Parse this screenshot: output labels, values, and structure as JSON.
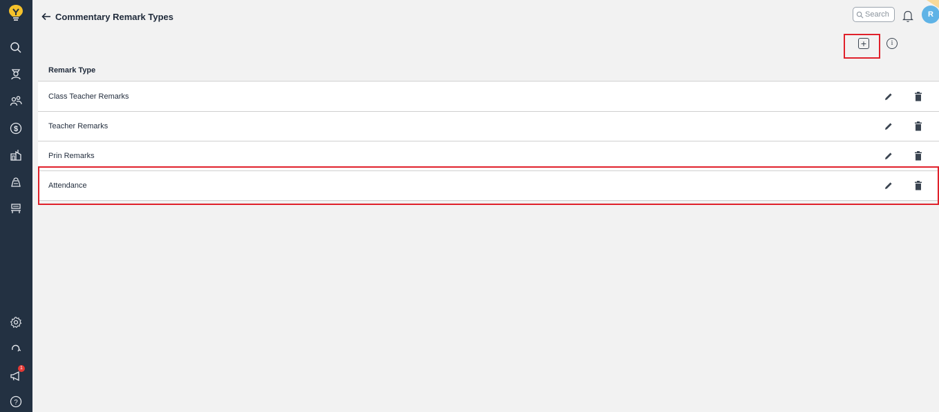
{
  "app": {
    "title": "Commentary Remark Types",
    "search_placeholder": "Search",
    "avatar_initial": "R",
    "notification_count": "1"
  },
  "sidebar": {
    "items": [
      {
        "icon": "search-icon"
      },
      {
        "icon": "student-icon"
      },
      {
        "icon": "users-icon"
      },
      {
        "icon": "dollar-icon"
      },
      {
        "icon": "school-icon"
      },
      {
        "icon": "bag-icon"
      },
      {
        "icon": "classroom-icon"
      },
      {
        "icon": "gear-icon"
      },
      {
        "icon": "refresh-icon"
      },
      {
        "icon": "megaphone-icon"
      },
      {
        "icon": "help-icon"
      }
    ]
  },
  "table": {
    "header": "Remark Type",
    "rows": [
      {
        "label": "Class Teacher Remarks"
      },
      {
        "label": "Teacher Remarks"
      },
      {
        "label": "Prin Remarks"
      },
      {
        "label": "Attendance"
      }
    ]
  },
  "colors": {
    "sidebar": "#233142",
    "highlight": "#e0202a",
    "avatar": "#5fb3e6",
    "background": "#f2f2f2"
  }
}
